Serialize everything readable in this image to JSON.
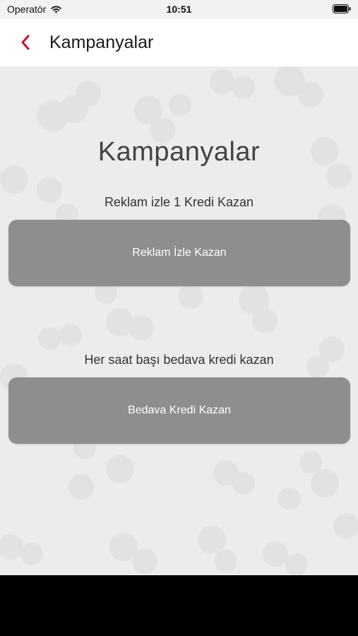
{
  "status_bar": {
    "carrier": "Operatör",
    "time": "10:51",
    "icons": [
      "wifi-icon",
      "battery-icon"
    ]
  },
  "nav": {
    "back_icon": "chevron-left-icon",
    "title": "Kampanyalar"
  },
  "main": {
    "title": "Kampanyalar",
    "sections": [
      {
        "caption": "Reklam izle 1 Kredi Kazan",
        "button_label": "Reklam İzle Kazan"
      },
      {
        "caption": "Her saat başı bedava kredi kazan",
        "button_label": "Bedava Kredi Kazan"
      }
    ]
  },
  "colors": {
    "accent": "#c8102e",
    "button_bg": "#8e8e8e",
    "content_bg": "#ececec"
  }
}
